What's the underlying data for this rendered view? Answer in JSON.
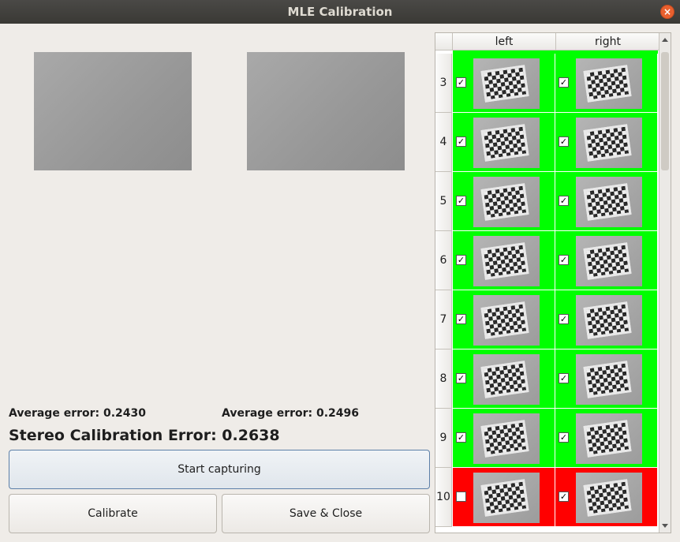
{
  "window": {
    "title": "MLE Calibration",
    "close_glyph": "×"
  },
  "left_panel": {
    "left_error_label": "Average error: 0.2430",
    "right_error_label": "Average error: 0.2496",
    "stereo_label": "Stereo Calibration Error: 0.2638",
    "start_button": "Start capturing",
    "calibrate_button": "Calibrate",
    "save_button": "Save & Close"
  },
  "table": {
    "headers": [
      "left",
      "right"
    ],
    "rows": [
      {
        "index": "3",
        "left_checked": "✓",
        "right_checked": "✓",
        "left_status": "ok",
        "right_status": "ok"
      },
      {
        "index": "4",
        "left_checked": "✓",
        "right_checked": "✓",
        "left_status": "ok",
        "right_status": "ok"
      },
      {
        "index": "5",
        "left_checked": "✓",
        "right_checked": "✓",
        "left_status": "ok",
        "right_status": "ok"
      },
      {
        "index": "6",
        "left_checked": "✓",
        "right_checked": "✓",
        "left_status": "ok",
        "right_status": "ok"
      },
      {
        "index": "7",
        "left_checked": "✓",
        "right_checked": "✓",
        "left_status": "ok",
        "right_status": "ok"
      },
      {
        "index": "8",
        "left_checked": "✓",
        "right_checked": "✓",
        "left_status": "ok",
        "right_status": "ok"
      },
      {
        "index": "9",
        "left_checked": "✓",
        "right_checked": "✓",
        "left_status": "ok",
        "right_status": "ok"
      },
      {
        "index": "10",
        "left_checked": "",
        "right_checked": "✓",
        "left_status": "bad",
        "right_status": "bad"
      }
    ]
  },
  "colors": {
    "ok": "#00ff00",
    "bad": "#ff0000",
    "titlebar": "#3f3e3a"
  }
}
